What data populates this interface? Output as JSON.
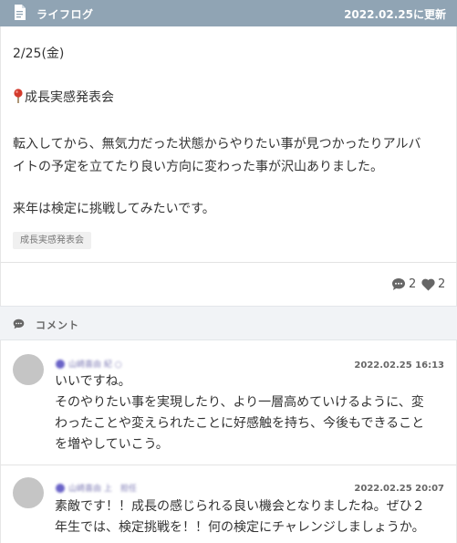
{
  "header": {
    "title": "ライフログ",
    "updated": "2022.02.25に更新",
    "icon": "document-icon",
    "bg_color": "#90a4b4"
  },
  "post": {
    "date": "2/25(金)",
    "heading": "成長実感発表会",
    "heading_icon": "pin-icon",
    "body_line1": "転入してから、無気力だった状態からやりたい事が見つかったりアルバ",
    "body_line2": "イトの予定を立てたり良い方向に変わった事が沢山ありました。",
    "body_line3": "来年は検定に挑戦してみたいです。",
    "tag": "成長実感発表会"
  },
  "stats": {
    "comment_count": "2",
    "like_count": "2"
  },
  "comments_section": {
    "label": "コメント"
  },
  "comments": [
    {
      "author": "山崎喜由 紀 ○",
      "time": "2022.02.25 16:13",
      "lines": [
        "いいですね。",
        "そのやりたい事を実現したり、より一層高めていけるように、変",
        "わったことや変えられたことに好感触を持ち、今後もできること",
        "を増やしていこう。"
      ]
    },
    {
      "author": "山崎喜由 上　担任",
      "time": "2022.02.25 20:07",
      "lines": [
        "素敵です！！成長の感じられる良い機会となりましたね。ぜひ２",
        "年生では、検定挑戦を！！何の検定にチャレンジしましょうか。"
      ]
    }
  ]
}
